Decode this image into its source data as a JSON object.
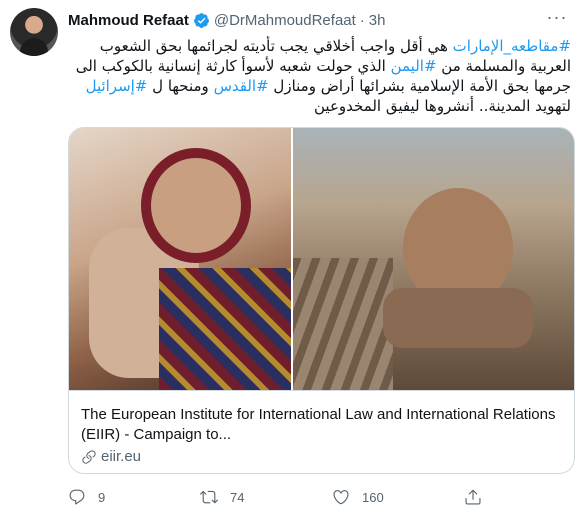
{
  "tweet": {
    "author_name": "Mahmoud Refaat",
    "handle": "@DrMahmoudRefaat",
    "separator": "·",
    "time": "3h",
    "more": "···",
    "lines": [
      {
        "tag": "#مقاطعه_الإمارات",
        "text": " هي أقل واجب أخلاقي يجب تأديته لجرائمها بحق الشعوب"
      },
      {
        "pre": "العربية والمسلمة من ",
        "tag": "#اليمن",
        "text": " الذي حولت شعبه لأسوأ كارثة إنسانية بالكوكب الى"
      },
      {
        "pre": "جرمها بحق الأمة الإسلامية بشرائها أراض ومنازل ",
        "tag": "#القدس",
        "mid": " ومنحها ل ",
        "tag2": "#إسرائيل"
      },
      {
        "text": "لتهويد المدينة.. أنشروها ليفيق المخدوعين"
      }
    ]
  },
  "card": {
    "title": "The European Institute for International Law and International Relations (EIIR) - Campaign to...",
    "domain": "eiir.eu"
  },
  "actions": {
    "reply_count": "9",
    "retweet_count": "74",
    "like_count": "160"
  },
  "colors": {
    "accent": "#1d9bf0",
    "text": "#0f1419",
    "muted": "#536471",
    "border": "#cfd9de"
  }
}
